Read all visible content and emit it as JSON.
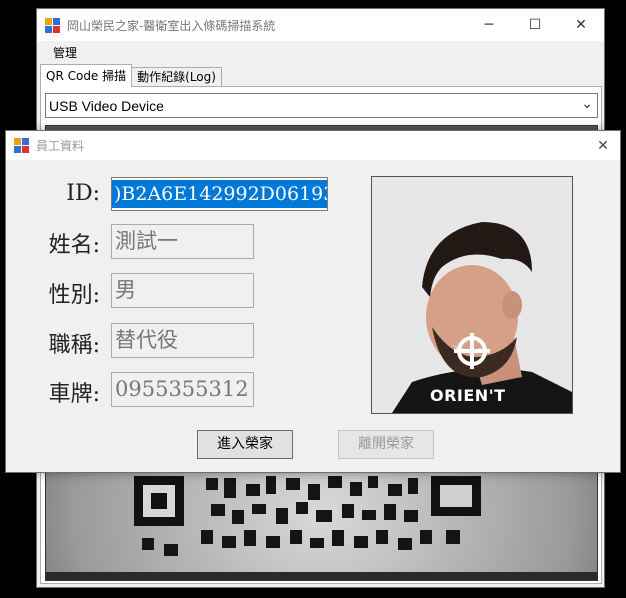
{
  "main_window": {
    "title": "岡山榮民之家-醫衛室出入條碼掃描系統",
    "controls": {
      "minimize": "─",
      "maximize": "☐",
      "close": "✕"
    },
    "menu": [
      "管理"
    ],
    "tabs": [
      {
        "label": "QR Code 掃描",
        "active": true
      },
      {
        "label": "動作紀錄(Log)",
        "active": false
      }
    ],
    "device_select": {
      "value": "USB Video Device"
    }
  },
  "dialog": {
    "title": "員工資料",
    "close": "✕",
    "fields": {
      "id": {
        "label": "ID:",
        "value": ")B2A6E142992D06193"
      },
      "name": {
        "label": "姓名:",
        "value": "測試一"
      },
      "gender": {
        "label": "性別:",
        "value": "男"
      },
      "title": {
        "label": "職稱:",
        "value": "替代役"
      },
      "plate": {
        "label": "車牌:",
        "value": "0955355312"
      }
    },
    "photo_caption": "ORIEN'T",
    "buttons": {
      "enter": "進入榮家",
      "leave": "離開榮家"
    }
  }
}
